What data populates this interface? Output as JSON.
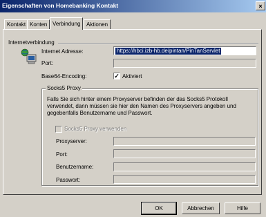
{
  "window": {
    "title": "Eigenschaften von Homebanking Kontakt",
    "close_glyph": "×"
  },
  "tabs": [
    "Kontakt",
    "Konten",
    "Verbindung",
    "Aktionen"
  ],
  "active_tab": "Verbindung",
  "internet": {
    "group_label": "Internetverbindung",
    "address_label": "Internet Adresse:",
    "address_value": "https://hbci.izb-hb.de/pintan/PinTanServlet",
    "port_label": "Port:",
    "port_value": "",
    "base64_label": "Base64-Encoding:",
    "base64_checkbox_label": "Aktiviert",
    "base64_checked": true
  },
  "socks": {
    "group_label": "Socks5 Proxy",
    "description": "Falls Sie sich hinter einem Proxyserver befinden der das Socks5 Protokoll verwendet, dann müssen sie hier den Namen des Proxyservers angeben und gegebenfalls Benutzername und Passwort.",
    "use_proxy_label": "Socks5 Proxy verwenden",
    "use_proxy_checked": false,
    "proxyserver_label": "Proxyserver:",
    "port_label": "Port:",
    "username_label": "Benutzername:",
    "password_label": "Passwort:"
  },
  "buttons": {
    "ok": "OK",
    "cancel": "Abbrechen",
    "help": "Hilfe"
  }
}
